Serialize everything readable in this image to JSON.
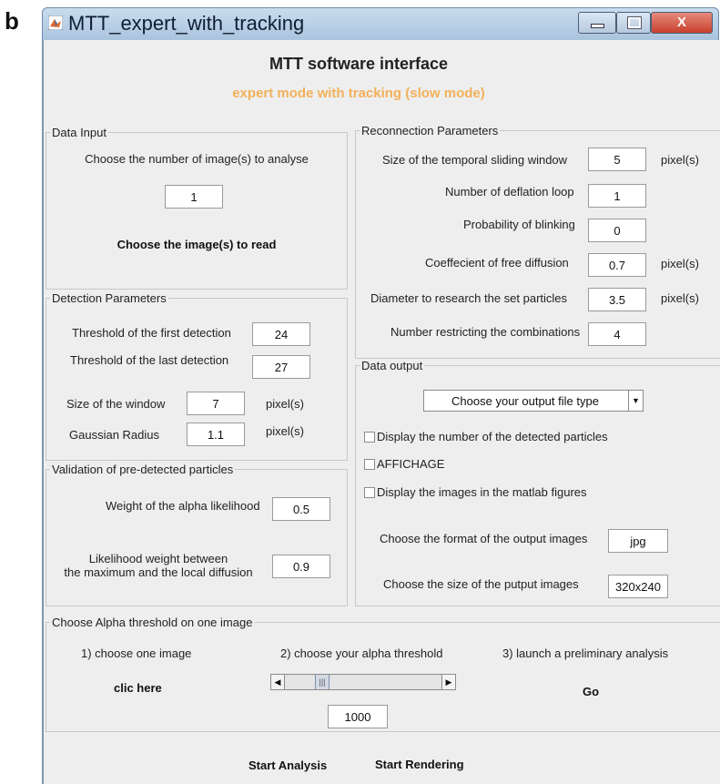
{
  "figure_panel": "b",
  "window": {
    "title": "MTT_expert_with_tracking",
    "controls": [
      "minimize",
      "maximize",
      "close"
    ],
    "close_glyph": "X"
  },
  "header": {
    "title": "MTT software interface",
    "subtitle": "expert mode with tracking (slow mode)"
  },
  "data_input": {
    "legend": "Data Input",
    "choose_label": "Choose the number of image(s) to analyse",
    "count_value": "1",
    "read_button": "Choose the image(s) to read"
  },
  "detection": {
    "legend": "Detection Parameters",
    "first_label": "Threshold of the first detection",
    "first_value": "24",
    "last_label": "Threshold of the last detection",
    "last_value": "27",
    "window_label": "Size of the window",
    "window_value": "7",
    "window_unit": "pixel(s)",
    "gauss_label": "Gaussian Radius",
    "gauss_value": "1.1",
    "gauss_unit": "pixel(s)"
  },
  "validation": {
    "legend": "Validation of pre-detected particles",
    "alpha_label": "Weight of the alpha likelihood",
    "alpha_value": "0.5",
    "likelihood_label_1": "Likelihood weight between",
    "likelihood_label_2": "the maximum and the local diffusion",
    "likelihood_value": "0.9"
  },
  "reconnection": {
    "legend": "Reconnection Parameters",
    "sliding_label": "Size of the temporal sliding window",
    "sliding_value": "5",
    "sliding_unit": "pixel(s)",
    "deflation_label": "Number of deflation loop",
    "deflation_value": "1",
    "blink_label": "Probability of blinking",
    "blink_value": "0",
    "diffusion_label": "Coeffecient of free diffusion",
    "diffusion_value": "0.7",
    "diffusion_unit": "pixel(s)",
    "diameter_label": "Diameter to research the set particles",
    "diameter_value": "3.5",
    "diameter_unit": "pixel(s)",
    "restrict_label": "Number restricting the combinations",
    "restrict_value": "4"
  },
  "output": {
    "legend": "Data output",
    "file_type_selected": "Choose your output file type",
    "check_detected": "Display the number of the detected particles",
    "check_affichage": "AFFICHAGE",
    "check_matlab": "Display the images in the matlab figures",
    "format_label": "Choose the format of the output images",
    "format_value": "jpg",
    "size_label": "Choose the size of the putput images",
    "size_value": "320x240"
  },
  "alpha": {
    "legend": "Choose Alpha threshold on one image",
    "step1": "1) choose one image",
    "step2": "2) choose your alpha threshold",
    "step3": "3) launch a preliminary analysis",
    "clic_button": "clic here",
    "go_button": "Go",
    "threshold_value": "1000"
  },
  "footer": {
    "start_analysis": "Start Analysis",
    "start_rendering": "Start Rendering"
  },
  "colors": {
    "subtitle": "#f2b15a",
    "close_button": "#c8402e",
    "window_bg": "#eeeeee"
  }
}
